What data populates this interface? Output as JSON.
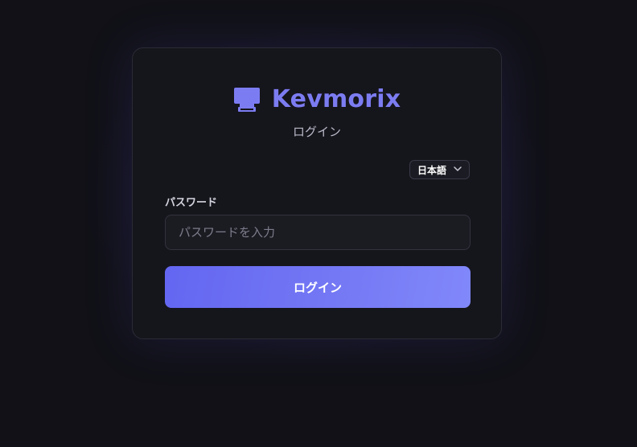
{
  "brand": {
    "name": "Kevmorix",
    "icon": "monitor-icon",
    "color": "#7c7cf2"
  },
  "subtitle": "ログイン",
  "language": {
    "selected": "日本語",
    "icon": "chevron-down-icon"
  },
  "password_field": {
    "label": "パスワード",
    "placeholder": "パスワードを入力",
    "value": ""
  },
  "submit": {
    "label": "ログイン",
    "gradient": [
      "#6366f1",
      "#8188fa"
    ]
  }
}
